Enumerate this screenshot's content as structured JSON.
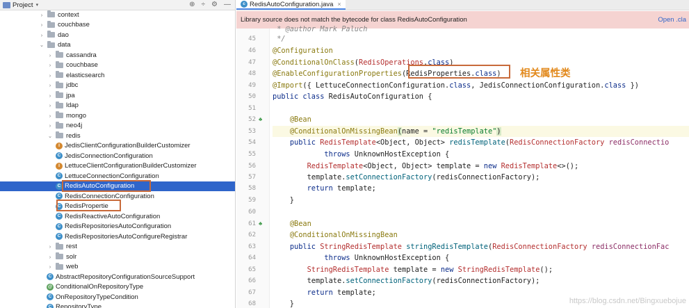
{
  "project_panel": {
    "title": "Project",
    "tools": [
      "⊕",
      "÷",
      "⚙",
      "—"
    ],
    "rows": [
      {
        "label": "context",
        "kind": "folder",
        "indent": 0,
        "arrow": "›"
      },
      {
        "label": "couchbase",
        "kind": "folder",
        "indent": 0,
        "arrow": "›"
      },
      {
        "label": "dao",
        "kind": "folder",
        "indent": 0,
        "arrow": "›"
      },
      {
        "label": "data",
        "kind": "folder",
        "indent": 0,
        "arrow": "⌄"
      },
      {
        "label": "cassandra",
        "kind": "folder",
        "indent": 1,
        "arrow": "›"
      },
      {
        "label": "couchbase",
        "kind": "folder",
        "indent": 1,
        "arrow": "›"
      },
      {
        "label": "elasticsearch",
        "kind": "folder",
        "indent": 1,
        "arrow": "›"
      },
      {
        "label": "jdbc",
        "kind": "folder",
        "indent": 1,
        "arrow": "›"
      },
      {
        "label": "jpa",
        "kind": "folder",
        "indent": 1,
        "arrow": "›"
      },
      {
        "label": "ldap",
        "kind": "folder",
        "indent": 1,
        "arrow": "›"
      },
      {
        "label": "mongo",
        "kind": "folder",
        "indent": 1,
        "arrow": "›"
      },
      {
        "label": "neo4j",
        "kind": "folder",
        "indent": 1,
        "arrow": "›"
      },
      {
        "label": "redis",
        "kind": "folder",
        "indent": 1,
        "arrow": "⌄"
      },
      {
        "label": "JedisClientConfigurationBuilderCustomizer",
        "kind": "orange",
        "indent": 2
      },
      {
        "label": "JedisConnectionConfiguration",
        "kind": "class",
        "indent": 2
      },
      {
        "label": "LettuceClientConfigurationBuilderCustomizer",
        "kind": "orange",
        "indent": 2
      },
      {
        "label": "LettuceConnectionConfiguration",
        "kind": "class",
        "indent": 2
      },
      {
        "label": "RedisAutoConfiguration",
        "kind": "class",
        "indent": 2,
        "selected": true
      },
      {
        "label": "RedisConnectionConfiguration",
        "kind": "class",
        "indent": 2
      },
      {
        "label": "RedisPropertie",
        "kind": "class",
        "indent": 2
      },
      {
        "label": "RedisReactiveAutoConfiguration",
        "kind": "class",
        "indent": 2
      },
      {
        "label": "RedisRepositoriesAutoConfiguration",
        "kind": "class",
        "indent": 2
      },
      {
        "label": "RedisRepositoriesAutoConfigureRegistrar",
        "kind": "class",
        "indent": 2
      },
      {
        "label": "rest",
        "kind": "folder",
        "indent": 1,
        "arrow": "›"
      },
      {
        "label": "solr",
        "kind": "folder",
        "indent": 1,
        "arrow": "›"
      },
      {
        "label": "web",
        "kind": "folder",
        "indent": 1,
        "arrow": "›"
      },
      {
        "label": "AbstractRepositoryConfigurationSourceSupport",
        "kind": "class",
        "indent": 1
      },
      {
        "label": "ConditionalOnRepositoryType",
        "kind": "green",
        "indent": 1
      },
      {
        "label": "OnRepositoryTypeCondition",
        "kind": "class",
        "indent": 1
      },
      {
        "label": "RepositoryType",
        "kind": "class",
        "indent": 1
      }
    ]
  },
  "editor": {
    "tab_label": "RedisAutoConfiguration.java",
    "banner_text": "Library source does not match the bytecode for class RedisAutoConfiguration",
    "banner_link": "Open .cla",
    "annotation_label": "相关属性类",
    "watermark": "https://blog.csdn.net/Bingxuebojue",
    "line_numbers": [
      "",
      "45",
      "46",
      "47",
      "48",
      "49",
      "50",
      "51",
      "52",
      "53",
      "54",
      "55",
      "56",
      "57",
      "58",
      "59",
      "60",
      "61",
      "62",
      "63",
      "64",
      "65",
      "66",
      "67",
      "68"
    ],
    "bean_lines": [
      "52",
      "61"
    ]
  },
  "colors": {
    "selection": "#2f65ca",
    "banner": "#f5d3d1",
    "highlight_box": "#c86a3a",
    "annotation_label": "#e28a1e"
  }
}
